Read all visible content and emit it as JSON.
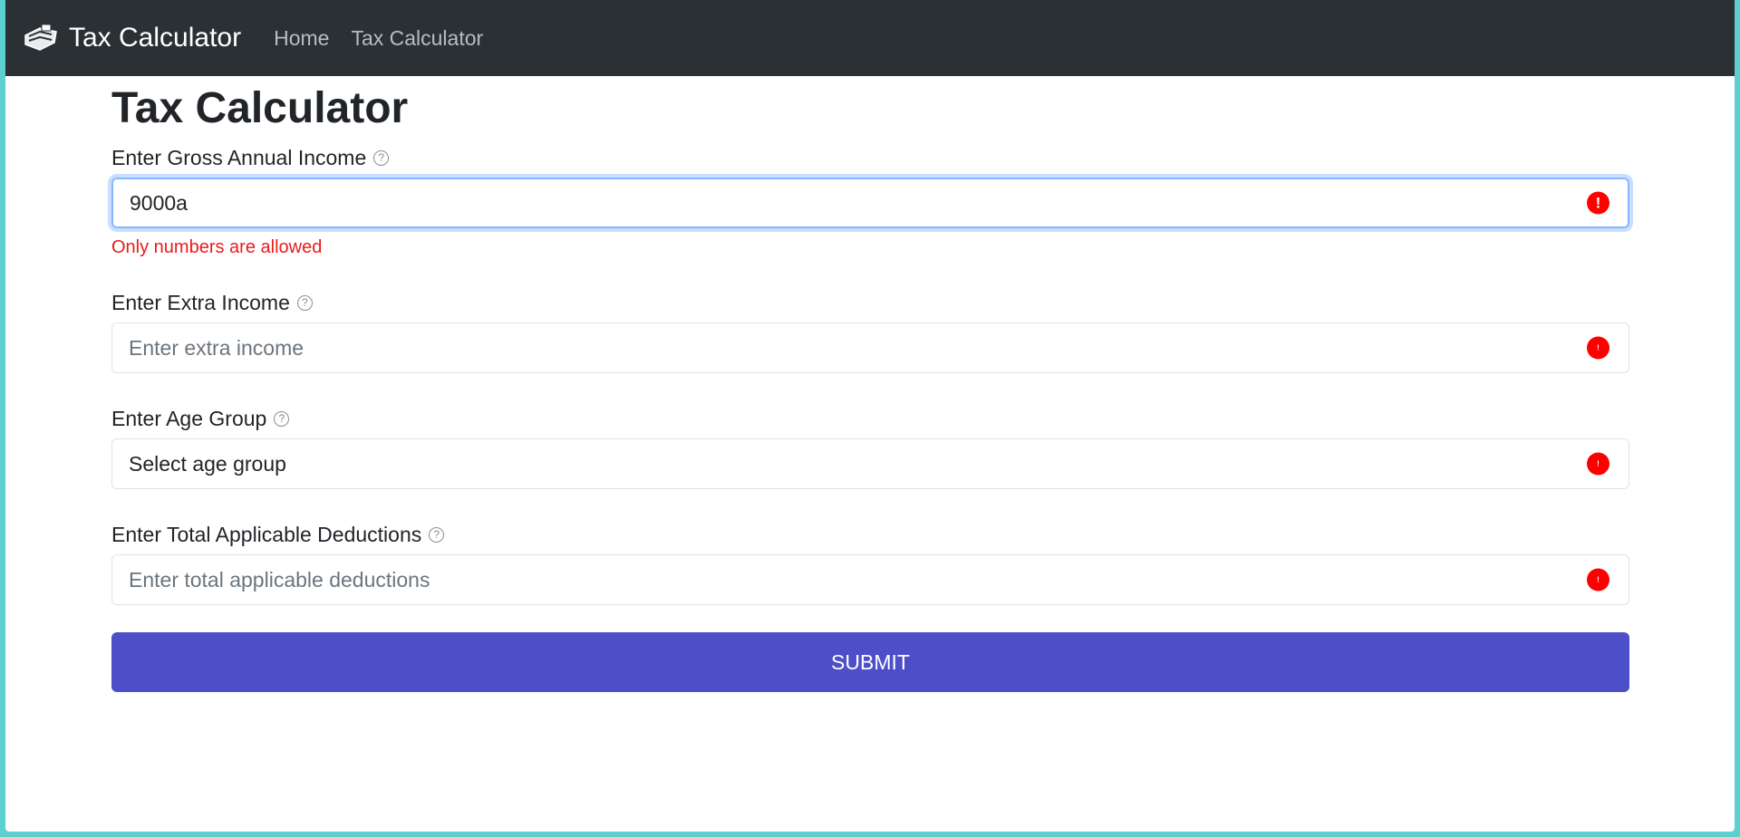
{
  "navbar": {
    "brand": "Tax Calculator",
    "links": [
      "Home",
      "Tax Calculator"
    ]
  },
  "page": {
    "title": "Tax Calculator"
  },
  "form": {
    "gross_income": {
      "label": "Enter Gross Annual Income",
      "value": "9000a",
      "error": "Only numbers are allowed"
    },
    "extra_income": {
      "label": "Enter Extra Income",
      "placeholder": "Enter extra income"
    },
    "age_group": {
      "label": "Enter Age Group",
      "selected": "Select age group"
    },
    "deductions": {
      "label": "Enter Total Applicable Deductions",
      "placeholder": "Enter total applicable deductions"
    },
    "submit_label": "SUBMIT"
  },
  "icons": {
    "help": "?",
    "error": "!"
  },
  "colors": {
    "navbar_bg": "#2b3035",
    "accent": "#4c4fc7",
    "error": "#ff0000",
    "backdrop": "#5ccfcf"
  }
}
